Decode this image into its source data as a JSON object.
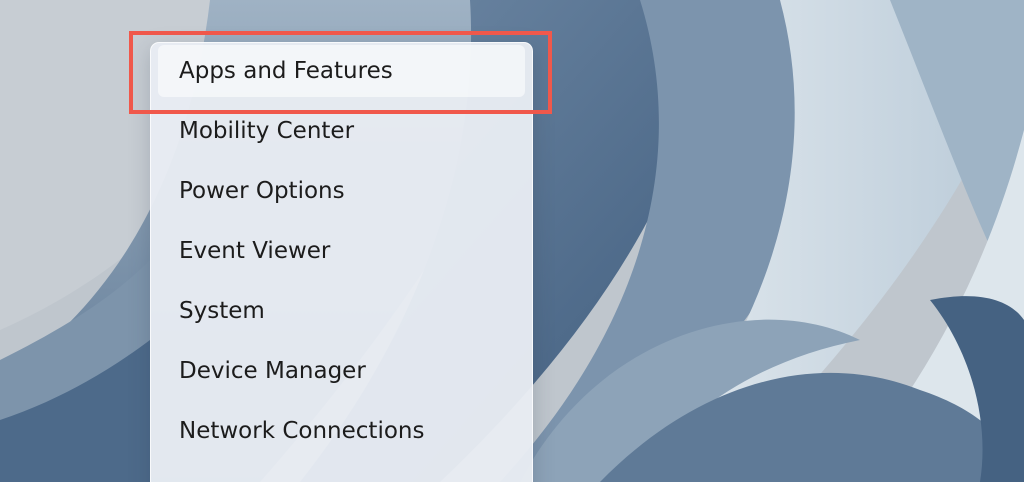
{
  "wallpaper": {
    "name": "Windows 11 bloom wallpaper",
    "colors": [
      "#c3c9cf",
      "#a9b8c6",
      "#6f89a5",
      "#3f5c7d",
      "#dde6ec"
    ]
  },
  "context_menu": {
    "items": [
      {
        "label": "Apps and Features",
        "state": "hovered"
      },
      {
        "label": "Mobility Center",
        "state": "normal"
      },
      {
        "label": "Power Options",
        "state": "normal"
      },
      {
        "label": "Event Viewer",
        "state": "normal"
      },
      {
        "label": "System",
        "state": "normal"
      },
      {
        "label": "Device Manager",
        "state": "normal"
      },
      {
        "label": "Network Connections",
        "state": "normal"
      }
    ]
  },
  "annotation": {
    "type": "highlight-rectangle",
    "color": "#f0584b",
    "target": "Apps and Features"
  }
}
